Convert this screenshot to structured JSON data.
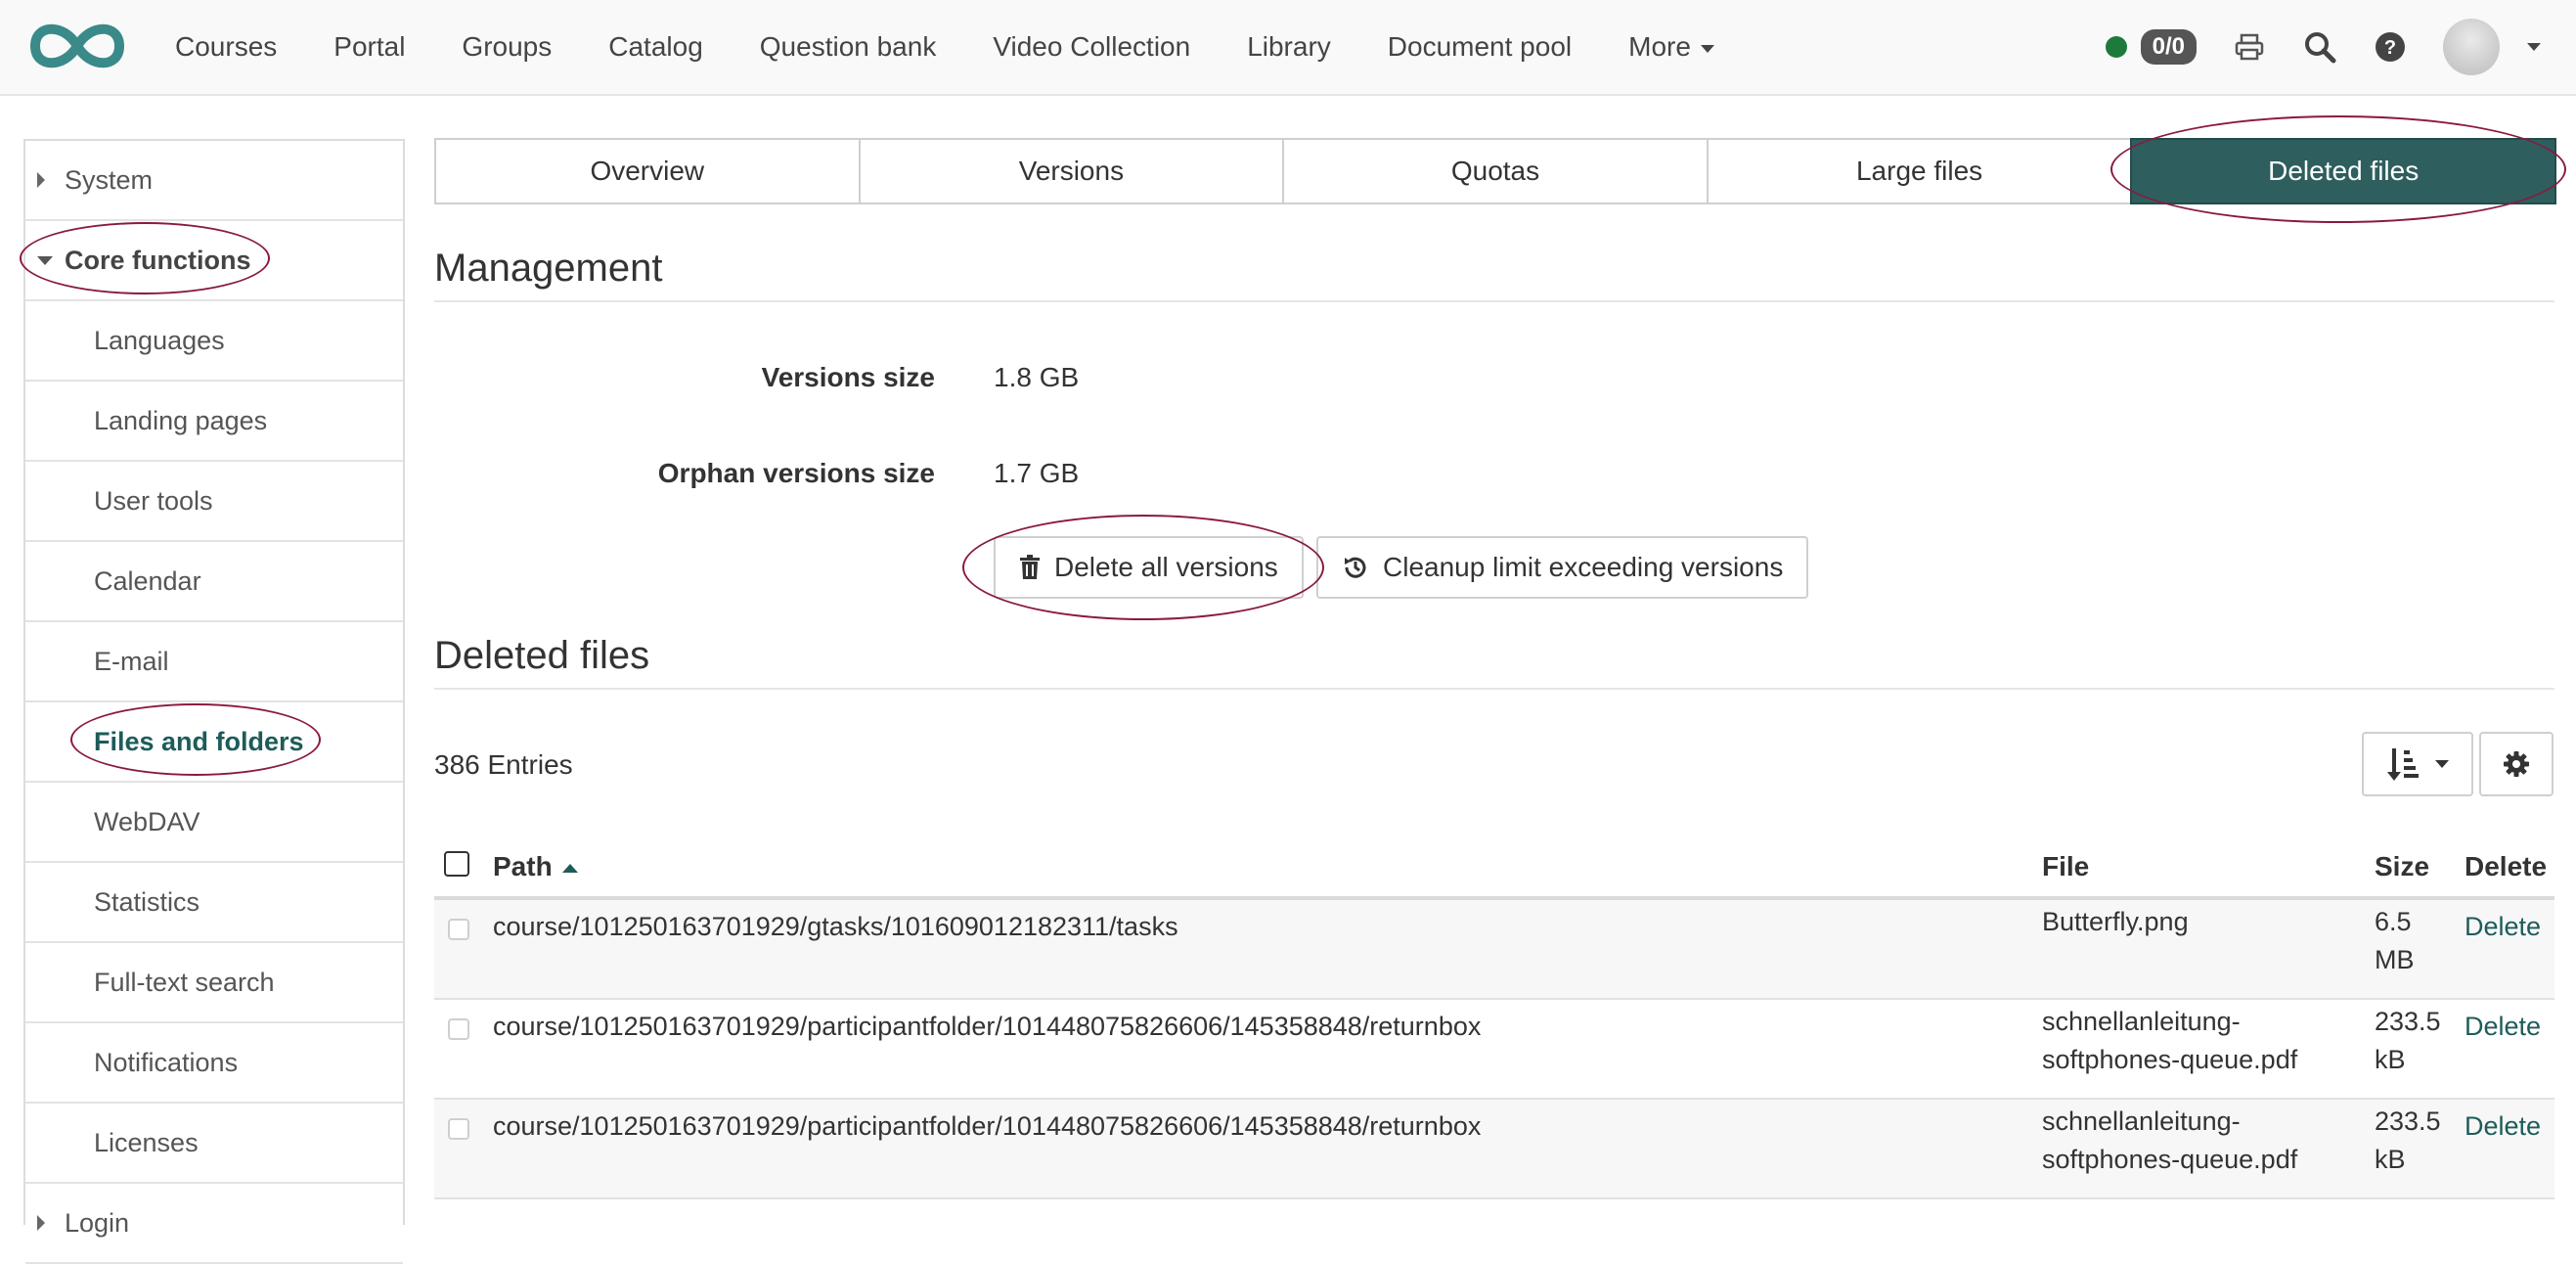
{
  "nav": {
    "items": [
      "Courses",
      "Portal",
      "Groups",
      "Catalog",
      "Question bank",
      "Video Collection",
      "Library",
      "Document pool"
    ],
    "more_label": "More"
  },
  "tools": {
    "badge": "0/0",
    "icons": [
      "status-dot",
      "print-icon",
      "search-icon",
      "help-icon",
      "avatar",
      "chevron-down-icon"
    ]
  },
  "sidebar": {
    "system_label": "System",
    "core_label": "Core functions",
    "items": [
      "Languages",
      "Landing pages",
      "User tools",
      "Calendar",
      "E-mail",
      "Files and folders",
      "WebDAV",
      "Statistics",
      "Full-text search",
      "Notifications",
      "Licenses"
    ],
    "next_label": "Login"
  },
  "tabs": [
    "Overview",
    "Versions",
    "Quotas",
    "Large files",
    "Deleted files"
  ],
  "management": {
    "title": "Management",
    "versions_size_label": "Versions size",
    "versions_size_value": "1.8 GB",
    "orphan_size_label": "Orphan versions size",
    "orphan_size_value": "1.7 GB",
    "delete_all_label": "Delete all versions",
    "cleanup_label": "Cleanup limit exceeding versions"
  },
  "deleted": {
    "title": "Deleted files",
    "entries": "386 Entries",
    "columns": {
      "path": "Path",
      "file": "File",
      "size": "Size",
      "delete": "Delete"
    },
    "rows": [
      {
        "path": "course/101250163701929/gtasks/101609012182311/tasks",
        "file": "Butterfly.png",
        "size": "6.5 MB",
        "action": "Delete"
      },
      {
        "path": "course/101250163701929/participantfolder/101448075826606/145358848/returnbox",
        "file": "schnellanleitung-softphones-queue.pdf",
        "size": "233.5 kB",
        "action": "Delete"
      },
      {
        "path": "course/101250163701929/participantfolder/101448075826606/145358848/returnbox",
        "file": "schnellanleitung-softphones-queue.pdf",
        "size": "233.5 kB",
        "action": "Delete"
      }
    ]
  },
  "colors": {
    "accent": "#2e5e5e",
    "link": "#1d5c5a",
    "annotation": "#8a1a3d",
    "status_online": "#1d7a3a"
  }
}
